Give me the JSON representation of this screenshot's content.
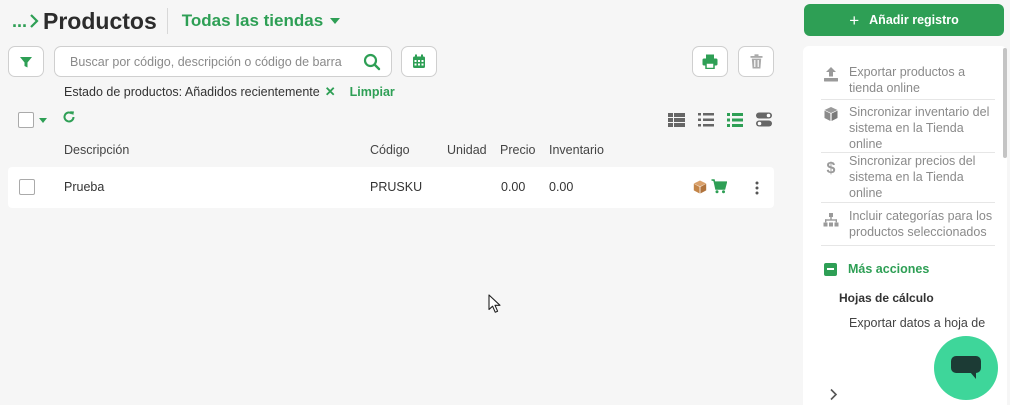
{
  "header": {
    "breadcrumb_ellipsis": "...",
    "title": "Productos",
    "store_selector": "Todas las tiendas"
  },
  "toolbar": {
    "search_placeholder": "Buscar por código, descripción o código de barra",
    "icons": [
      "filter-icon",
      "search-icon",
      "calendar-icon",
      "printer-icon",
      "trash-icon"
    ]
  },
  "filter": {
    "label": "Estado de productos: Añadidos recientemente",
    "remove": "✕",
    "clear": "Limpiar"
  },
  "table": {
    "columns": [
      "Descripción",
      "Código",
      "Unidad",
      "Precio",
      "Inventario"
    ],
    "rows": [
      {
        "description": "Prueba",
        "code": "PRUSKU",
        "unit": "",
        "price": "0.00",
        "inventory": "0.00"
      }
    ]
  },
  "sidebar": {
    "add_button": "Añadir registro",
    "items": [
      {
        "label": "Exportar productos a tienda online",
        "icon": "upload-icon"
      },
      {
        "label": "Sincronizar inventario del sistema en la Tienda online",
        "icon": "cube-icon"
      },
      {
        "label": "Sincronizar precios del sistema en la Tienda online",
        "icon": "dollar-icon"
      },
      {
        "label": "Incluir categorías para los productos seleccionados",
        "icon": "hierarchy-icon"
      }
    ],
    "more_actions": "Más acciones",
    "sheets_title": "Hojas de cálculo",
    "export_sheet": "Exportar datos a hoja de"
  },
  "colors": {
    "accent": "#2e9f55",
    "chat": "#3ed69a",
    "muted": "#8a8a8a"
  }
}
